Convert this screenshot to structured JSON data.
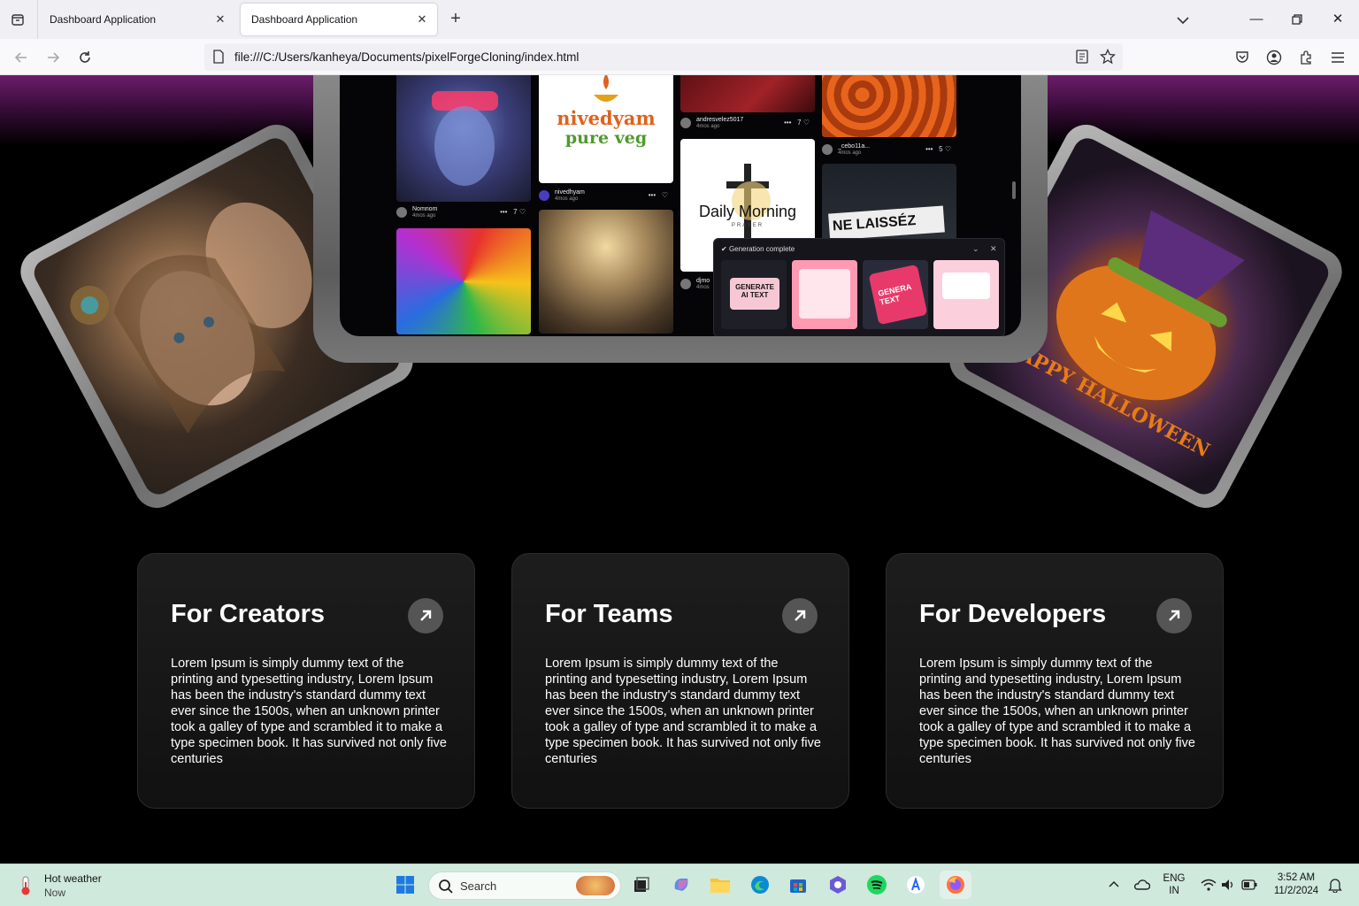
{
  "browser": {
    "tabs": [
      {
        "title": "Dashboard Application",
        "active": false
      },
      {
        "title": "Dashboard Application",
        "active": true
      }
    ],
    "url": "file:///C:/Users/kanheya/Documents/pixelForgeCloning/index.html"
  },
  "gallery": {
    "posts": [
      {
        "user": "Nomnom",
        "time": "4mos ago",
        "likes": "7"
      },
      {
        "user": "nivedhyam",
        "time": "4mos ago",
        "likes": ""
      },
      {
        "user": "andresvelez5017",
        "time": "4mos ago",
        "likes": "7"
      },
      {
        "user": "_cebo11a...",
        "time": "4mos ago",
        "likes": "5"
      },
      {
        "user": "djmo",
        "time": "4mos"
      }
    ],
    "logo_text_1": "nivedyam",
    "logo_text_2": "pure veg",
    "daily_text": "Daily Morning",
    "daily_sub": "PRAYER",
    "poster_text": "NE LAISSÉZ",
    "toast_title": "Generation complete",
    "thumb_text_1": "GENERATE AI TEXT",
    "thumb_text_2": "GENERA TEXT",
    "halloween_text": "HAPPY HALLOWEEN"
  },
  "features": [
    {
      "title": "For Creators",
      "body": "Lorem Ipsum is simply dummy text of the printing and typesetting industry, Lorem Ipsum has been the industry's standard dummy text ever since the 1500s, when an unknown printer took a galley of type and scrambled it to make a type specimen book. It has survived not only five centuries"
    },
    {
      "title": "For Teams",
      "body": "Lorem Ipsum is simply dummy text of the printing and typesetting industry, Lorem Ipsum has been the industry's standard dummy text ever since the 1500s, when an unknown printer took a galley of type and scrambled it to make a type specimen book. It has survived not only five centuries"
    },
    {
      "title": "For Developers",
      "body": "Lorem Ipsum is simply dummy text of the printing and typesetting industry, Lorem Ipsum has been the industry's standard dummy text ever since the 1500s, when an unknown printer took a galley of type and scrambled it to make a type specimen book. It has survived not only five centuries"
    }
  ],
  "taskbar": {
    "weather_title": "Hot weather",
    "weather_sub": "Now",
    "search_placeholder": "Search",
    "lang_1": "ENG",
    "lang_2": "IN",
    "time": "3:52 AM",
    "date": "11/2/2024"
  },
  "colors": {
    "page_bg": "#000000",
    "card_bg": "#1a1a1a",
    "glow": "#6c1d6b",
    "taskbar_bg": "#cfe9dc"
  }
}
